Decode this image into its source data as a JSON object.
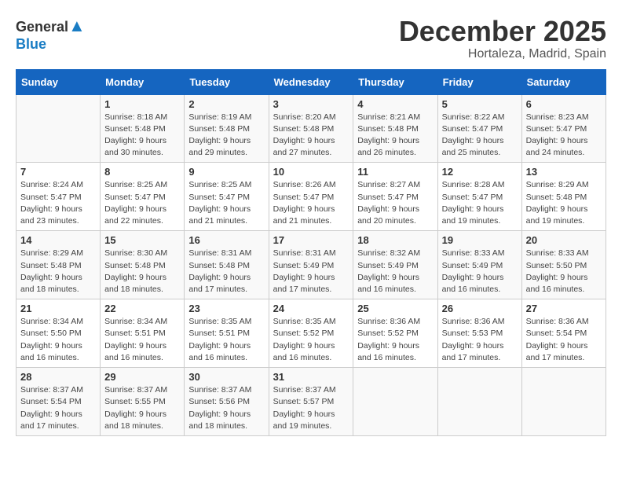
{
  "logo": {
    "general": "General",
    "blue": "Blue"
  },
  "header": {
    "month": "December 2025",
    "location": "Hortaleza, Madrid, Spain"
  },
  "days_of_week": [
    "Sunday",
    "Monday",
    "Tuesday",
    "Wednesday",
    "Thursday",
    "Friday",
    "Saturday"
  ],
  "weeks": [
    [
      {
        "day": "",
        "sunrise": "",
        "sunset": "",
        "daylight": ""
      },
      {
        "day": "1",
        "sunrise": "Sunrise: 8:18 AM",
        "sunset": "Sunset: 5:48 PM",
        "daylight": "Daylight: 9 hours and 30 minutes."
      },
      {
        "day": "2",
        "sunrise": "Sunrise: 8:19 AM",
        "sunset": "Sunset: 5:48 PM",
        "daylight": "Daylight: 9 hours and 29 minutes."
      },
      {
        "day": "3",
        "sunrise": "Sunrise: 8:20 AM",
        "sunset": "Sunset: 5:48 PM",
        "daylight": "Daylight: 9 hours and 27 minutes."
      },
      {
        "day": "4",
        "sunrise": "Sunrise: 8:21 AM",
        "sunset": "Sunset: 5:48 PM",
        "daylight": "Daylight: 9 hours and 26 minutes."
      },
      {
        "day": "5",
        "sunrise": "Sunrise: 8:22 AM",
        "sunset": "Sunset: 5:47 PM",
        "daylight": "Daylight: 9 hours and 25 minutes."
      },
      {
        "day": "6",
        "sunrise": "Sunrise: 8:23 AM",
        "sunset": "Sunset: 5:47 PM",
        "daylight": "Daylight: 9 hours and 24 minutes."
      }
    ],
    [
      {
        "day": "7",
        "sunrise": "Sunrise: 8:24 AM",
        "sunset": "Sunset: 5:47 PM",
        "daylight": "Daylight: 9 hours and 23 minutes."
      },
      {
        "day": "8",
        "sunrise": "Sunrise: 8:25 AM",
        "sunset": "Sunset: 5:47 PM",
        "daylight": "Daylight: 9 hours and 22 minutes."
      },
      {
        "day": "9",
        "sunrise": "Sunrise: 8:25 AM",
        "sunset": "Sunset: 5:47 PM",
        "daylight": "Daylight: 9 hours and 21 minutes."
      },
      {
        "day": "10",
        "sunrise": "Sunrise: 8:26 AM",
        "sunset": "Sunset: 5:47 PM",
        "daylight": "Daylight: 9 hours and 21 minutes."
      },
      {
        "day": "11",
        "sunrise": "Sunrise: 8:27 AM",
        "sunset": "Sunset: 5:47 PM",
        "daylight": "Daylight: 9 hours and 20 minutes."
      },
      {
        "day": "12",
        "sunrise": "Sunrise: 8:28 AM",
        "sunset": "Sunset: 5:47 PM",
        "daylight": "Daylight: 9 hours and 19 minutes."
      },
      {
        "day": "13",
        "sunrise": "Sunrise: 8:29 AM",
        "sunset": "Sunset: 5:48 PM",
        "daylight": "Daylight: 9 hours and 19 minutes."
      }
    ],
    [
      {
        "day": "14",
        "sunrise": "Sunrise: 8:29 AM",
        "sunset": "Sunset: 5:48 PM",
        "daylight": "Daylight: 9 hours and 18 minutes."
      },
      {
        "day": "15",
        "sunrise": "Sunrise: 8:30 AM",
        "sunset": "Sunset: 5:48 PM",
        "daylight": "Daylight: 9 hours and 18 minutes."
      },
      {
        "day": "16",
        "sunrise": "Sunrise: 8:31 AM",
        "sunset": "Sunset: 5:48 PM",
        "daylight": "Daylight: 9 hours and 17 minutes."
      },
      {
        "day": "17",
        "sunrise": "Sunrise: 8:31 AM",
        "sunset": "Sunset: 5:49 PM",
        "daylight": "Daylight: 9 hours and 17 minutes."
      },
      {
        "day": "18",
        "sunrise": "Sunrise: 8:32 AM",
        "sunset": "Sunset: 5:49 PM",
        "daylight": "Daylight: 9 hours and 16 minutes."
      },
      {
        "day": "19",
        "sunrise": "Sunrise: 8:33 AM",
        "sunset": "Sunset: 5:49 PM",
        "daylight": "Daylight: 9 hours and 16 minutes."
      },
      {
        "day": "20",
        "sunrise": "Sunrise: 8:33 AM",
        "sunset": "Sunset: 5:50 PM",
        "daylight": "Daylight: 9 hours and 16 minutes."
      }
    ],
    [
      {
        "day": "21",
        "sunrise": "Sunrise: 8:34 AM",
        "sunset": "Sunset: 5:50 PM",
        "daylight": "Daylight: 9 hours and 16 minutes."
      },
      {
        "day": "22",
        "sunrise": "Sunrise: 8:34 AM",
        "sunset": "Sunset: 5:51 PM",
        "daylight": "Daylight: 9 hours and 16 minutes."
      },
      {
        "day": "23",
        "sunrise": "Sunrise: 8:35 AM",
        "sunset": "Sunset: 5:51 PM",
        "daylight": "Daylight: 9 hours and 16 minutes."
      },
      {
        "day": "24",
        "sunrise": "Sunrise: 8:35 AM",
        "sunset": "Sunset: 5:52 PM",
        "daylight": "Daylight: 9 hours and 16 minutes."
      },
      {
        "day": "25",
        "sunrise": "Sunrise: 8:36 AM",
        "sunset": "Sunset: 5:52 PM",
        "daylight": "Daylight: 9 hours and 16 minutes."
      },
      {
        "day": "26",
        "sunrise": "Sunrise: 8:36 AM",
        "sunset": "Sunset: 5:53 PM",
        "daylight": "Daylight: 9 hours and 17 minutes."
      },
      {
        "day": "27",
        "sunrise": "Sunrise: 8:36 AM",
        "sunset": "Sunset: 5:54 PM",
        "daylight": "Daylight: 9 hours and 17 minutes."
      }
    ],
    [
      {
        "day": "28",
        "sunrise": "Sunrise: 8:37 AM",
        "sunset": "Sunset: 5:54 PM",
        "daylight": "Daylight: 9 hours and 17 minutes."
      },
      {
        "day": "29",
        "sunrise": "Sunrise: 8:37 AM",
        "sunset": "Sunset: 5:55 PM",
        "daylight": "Daylight: 9 hours and 18 minutes."
      },
      {
        "day": "30",
        "sunrise": "Sunrise: 8:37 AM",
        "sunset": "Sunset: 5:56 PM",
        "daylight": "Daylight: 9 hours and 18 minutes."
      },
      {
        "day": "31",
        "sunrise": "Sunrise: 8:37 AM",
        "sunset": "Sunset: 5:57 PM",
        "daylight": "Daylight: 9 hours and 19 minutes."
      },
      {
        "day": "",
        "sunrise": "",
        "sunset": "",
        "daylight": ""
      },
      {
        "day": "",
        "sunrise": "",
        "sunset": "",
        "daylight": ""
      },
      {
        "day": "",
        "sunrise": "",
        "sunset": "",
        "daylight": ""
      }
    ]
  ]
}
